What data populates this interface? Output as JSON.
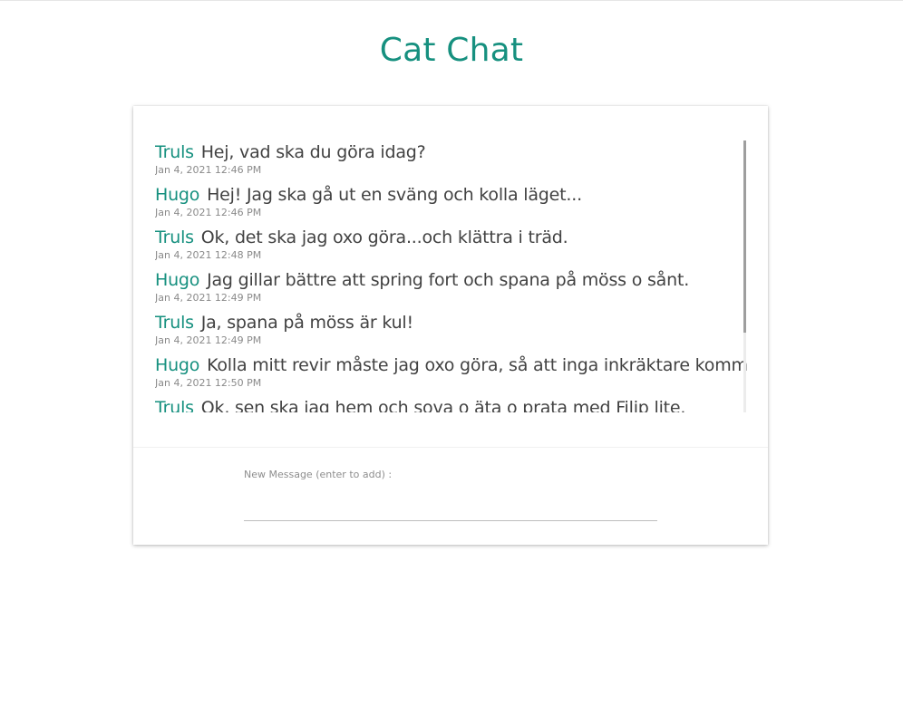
{
  "app": {
    "title": "Cat Chat"
  },
  "chat": {
    "messages": [
      {
        "author": "Truls",
        "text": "Hej, vad ska du göra idag?",
        "time": "Jan 4, 2021 12:46 PM"
      },
      {
        "author": "Hugo",
        "text": "Hej! Jag ska gå ut en sväng och kolla läget...",
        "time": "Jan 4, 2021 12:46 PM"
      },
      {
        "author": "Truls",
        "text": "Ok, det ska jag oxo göra...och klättra i träd.",
        "time": "Jan 4, 2021 12:48 PM"
      },
      {
        "author": "Hugo",
        "text": "Jag gillar bättre att spring fort och spana på möss o sånt.",
        "time": "Jan 4, 2021 12:49 PM"
      },
      {
        "author": "Truls",
        "text": "Ja, spana på möss är kul!",
        "time": "Jan 4, 2021 12:49 PM"
      },
      {
        "author": "Hugo",
        "text": "Kolla mitt revir måste jag oxo göra, så att inga inkräktare kommer.",
        "time": "Jan 4, 2021 12:50 PM"
      },
      {
        "author": "Truls",
        "text": "Ok, sen ska jag hem och sova o äta o prata med Filip lite.",
        "time": ""
      }
    ]
  },
  "composer": {
    "label": "New Message (enter to add) :",
    "value": "",
    "placeholder": ""
  },
  "colors": {
    "accent": "#16907f",
    "text": "#424242",
    "muted": "#8a8a8a"
  }
}
